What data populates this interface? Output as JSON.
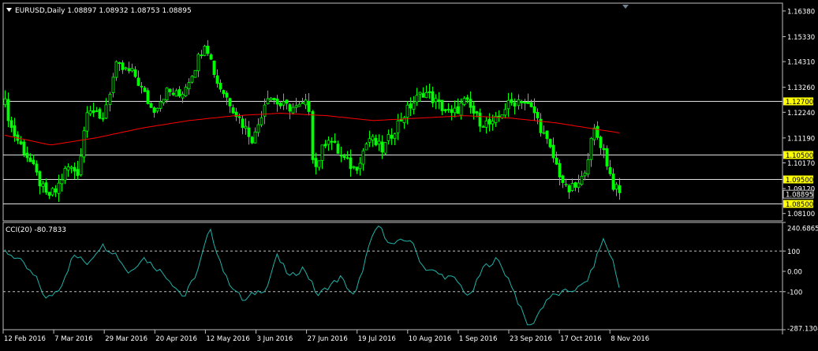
{
  "main_panel": {
    "title": "EURUSD,Daily  1.08897 1.08932 1.08753 1.08895",
    "price_labels": [
      "1.16380",
      "1.15330",
      "1.14310",
      "1.13260",
      "1.12240",
      "1.11190",
      "1.10170",
      "1.09120",
      "1.08100"
    ],
    "current_price_label": "1.08895",
    "levels": [
      {
        "label": "1.12700",
        "price": 1.127
      },
      {
        "label": "1.10500",
        "price": 1.105
      },
      {
        "label": "1.09500",
        "price": 1.095
      },
      {
        "label": "1.08500",
        "price": 1.085
      }
    ]
  },
  "cci_panel": {
    "title": "CCI(20) -80.7833",
    "axis_labels": {
      "max": "240.6865",
      "upper": "100",
      "zero": "0.00",
      "lower": "-100",
      "min": "-287.1304"
    }
  },
  "x_axis_labels": [
    "12 Feb 2016",
    "7 Mar 2016",
    "29 Mar 2016",
    "20 Apr 2016",
    "12 May 2016",
    "3 Jun 2016",
    "27 Jun 2016",
    "19 Jul 2016",
    "10 Aug 2016",
    "1 Sep 2016",
    "23 Sep 2016",
    "17 Oct 2016",
    "8 Nov 2016"
  ],
  "chart_data": [
    {
      "type": "candlestick",
      "title": "EURUSD,Daily  1.08897 1.08932 1.08753 1.08895",
      "ylim": [
        1.078,
        1.167
      ],
      "bar_count": 195,
      "anchors": [
        [
          0,
          1.126
        ],
        [
          3,
          1.115
        ],
        [
          10,
          1.104
        ],
        [
          18,
          1.088
        ],
        [
          22,
          1.09
        ],
        [
          27,
          1.1
        ],
        [
          32,
          1.098
        ],
        [
          36,
          1.126
        ],
        [
          42,
          1.118
        ],
        [
          48,
          1.141
        ],
        [
          56,
          1.138
        ],
        [
          64,
          1.123
        ],
        [
          70,
          1.131
        ],
        [
          76,
          1.129
        ],
        [
          82,
          1.14
        ],
        [
          87,
          1.152
        ],
        [
          92,
          1.135
        ],
        [
          98,
          1.126
        ],
        [
          103,
          1.118
        ],
        [
          108,
          1.111
        ],
        [
          114,
          1.13
        ],
        [
          120,
          1.125
        ],
        [
          127,
          1.124
        ],
        [
          132,
          1.126
        ],
        [
          134,
          1.098
        ],
        [
          140,
          1.113
        ],
        [
          146,
          1.104
        ],
        [
          152,
          1.099
        ],
        [
          158,
          1.112
        ],
        [
          164,
          1.107
        ],
        [
          170,
          1.117
        ],
        [
          176,
          1.125
        ],
        [
          182,
          1.131
        ],
        [
          188,
          1.126
        ],
        [
          194,
          1.121
        ],
        [
          200,
          1.127
        ],
        [
          206,
          1.119
        ],
        [
          212,
          1.117
        ],
        [
          218,
          1.125
        ],
        [
          224,
          1.128
        ],
        [
          230,
          1.122
        ],
        [
          238,
          1.104
        ],
        [
          244,
          1.09
        ],
        [
          250,
          1.093
        ],
        [
          256,
          1.115
        ],
        [
          260,
          1.107
        ],
        [
          264,
          1.093
        ],
        [
          267,
          1.0889
        ]
      ],
      "moving_average": {
        "anchors": [
          [
            0,
            1.113
          ],
          [
            20,
            1.109
          ],
          [
            40,
            1.112
          ],
          [
            60,
            1.116
          ],
          [
            80,
            1.119
          ],
          [
            100,
            1.121
          ],
          [
            120,
            1.122
          ],
          [
            140,
            1.121
          ],
          [
            160,
            1.119
          ],
          [
            180,
            1.12
          ],
          [
            200,
            1.121
          ],
          [
            220,
            1.12
          ],
          [
            240,
            1.118
          ],
          [
            260,
            1.115
          ],
          [
            267,
            1.114
          ]
        ]
      }
    },
    {
      "type": "line",
      "name": "CCI(20)",
      "ylim": [
        -287.1304,
        240.6865
      ],
      "reference_lines": [
        100,
        -100
      ],
      "anchors": [
        [
          0,
          100
        ],
        [
          6,
          60
        ],
        [
          14,
          -40
        ],
        [
          18,
          -140
        ],
        [
          24,
          -80
        ],
        [
          30,
          80
        ],
        [
          36,
          40
        ],
        [
          42,
          130
        ],
        [
          48,
          90
        ],
        [
          54,
          -10
        ],
        [
          60,
          70
        ],
        [
          70,
          -20
        ],
        [
          78,
          -130
        ],
        [
          84,
          10
        ],
        [
          89,
          210
        ],
        [
          96,
          -30
        ],
        [
          104,
          -150
        ],
        [
          108,
          -110
        ],
        [
          114,
          -80
        ],
        [
          118,
          80
        ],
        [
          124,
          -30
        ],
        [
          130,
          20
        ],
        [
          136,
          -120
        ],
        [
          140,
          -80
        ],
        [
          146,
          -30
        ],
        [
          152,
          -130
        ],
        [
          158,
          110
        ],
        [
          162,
          230
        ],
        [
          168,
          130
        ],
        [
          176,
          160
        ],
        [
          182,
          20
        ],
        [
          190,
          -20
        ],
        [
          196,
          -40
        ],
        [
          202,
          -130
        ],
        [
          208,
          20
        ],
        [
          214,
          60
        ],
        [
          220,
          -60
        ],
        [
          224,
          -180
        ],
        [
          228,
          -280
        ],
        [
          236,
          -130
        ],
        [
          244,
          -100
        ],
        [
          250,
          -80
        ],
        [
          254,
          -30
        ],
        [
          260,
          160
        ],
        [
          264,
          60
        ],
        [
          267,
          -80
        ]
      ]
    }
  ],
  "colors": {
    "background": "#000000",
    "grid": "#c0c0c0",
    "candle": "#00ff00",
    "ma_line": "#ff0000",
    "cci_line": "#20b2aa",
    "level_badge": "#ffff00"
  }
}
